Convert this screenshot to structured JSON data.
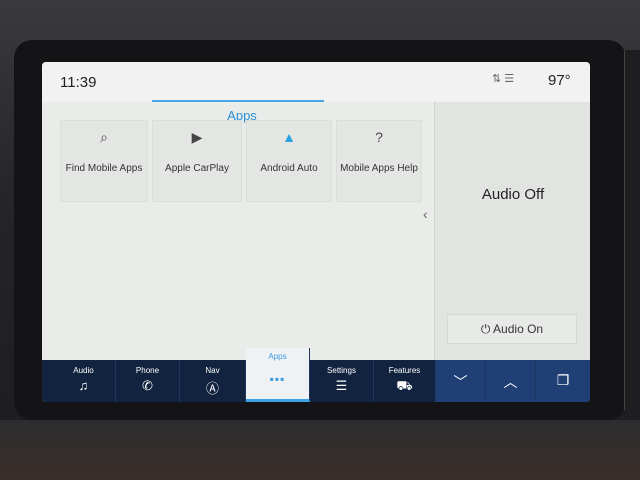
{
  "status": {
    "time": "11:39",
    "icons": "⇅ ☰",
    "temperature": "97°"
  },
  "apps": {
    "title": "Apps",
    "tiles": [
      {
        "label": "Find Mobile Apps",
        "icon": "⌕"
      },
      {
        "label": "Apple CarPlay",
        "icon": "▶"
      },
      {
        "label": "Android Auto",
        "icon": "▲"
      },
      {
        "label": "Mobile Apps Help",
        "icon": "?"
      }
    ],
    "collapse_icon": "‹"
  },
  "audio": {
    "state_label": "Audio Off",
    "on_button_label": "⏻ Audio On"
  },
  "nav": {
    "items": [
      {
        "label": "Audio",
        "icon": "♫"
      },
      {
        "label": "Phone",
        "icon": "✆"
      },
      {
        "label": "Nav",
        "icon": "Ⓐ"
      },
      {
        "label": "Apps",
        "icon": "▪▪▪"
      },
      {
        "label": "Settings",
        "icon": "☰"
      },
      {
        "label": "Features",
        "icon": "⛟"
      }
    ],
    "down_icon": "﹀",
    "up_icon": "︿",
    "windows_icon": "❐"
  }
}
